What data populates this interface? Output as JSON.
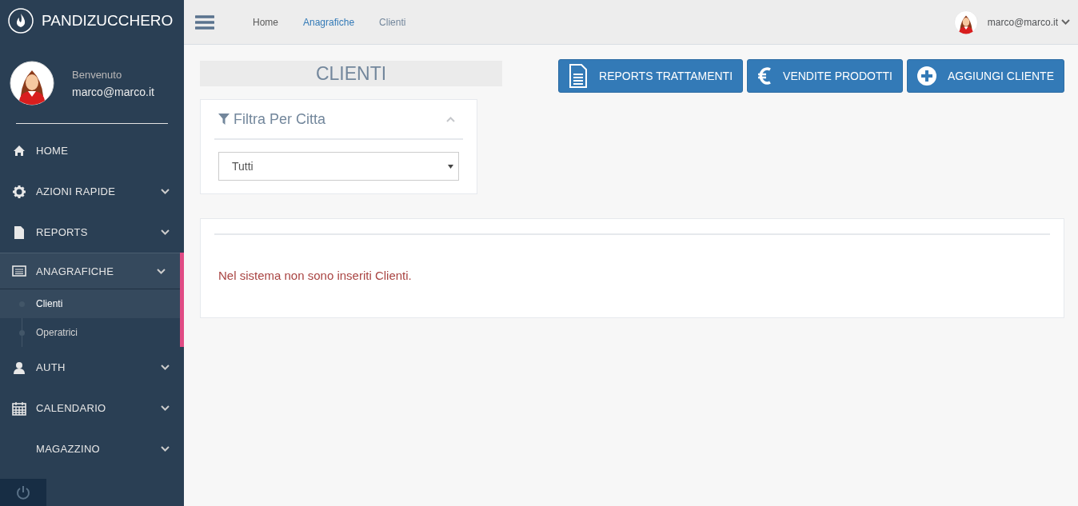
{
  "brand": {
    "title": "PANDIZUCCHERO"
  },
  "profile": {
    "greeting": "Benvenuto",
    "user": "marco@marco.it"
  },
  "sidebar": {
    "items": [
      {
        "label": "HOME",
        "kind": "link",
        "selected": false
      },
      {
        "label": "AZIONI RAPIDE",
        "kind": "submenu",
        "selected": false
      },
      {
        "label": "REPORTS",
        "kind": "submenu",
        "selected": false
      },
      {
        "label": "ANAGRAFICHE",
        "kind": "submenu",
        "expanded": true,
        "selected": true,
        "children": [
          {
            "label": "Clienti",
            "selected": true
          },
          {
            "label": "Operatrici",
            "selected": false
          }
        ]
      },
      {
        "label": "AUTH",
        "kind": "submenu",
        "selected": false
      },
      {
        "label": "CALENDARIO",
        "kind": "submenu",
        "selected": false
      },
      {
        "label": "MAGAZZINO",
        "kind": "submenu",
        "selected": false
      }
    ]
  },
  "breadcrumb": [
    {
      "label": "Home",
      "kind": "plain"
    },
    {
      "label": "Anagrafiche",
      "kind": "link"
    },
    {
      "label": "Clienti",
      "kind": "current"
    }
  ],
  "top_user": {
    "label": "marco@marco.it"
  },
  "page_title": "CLIENTI",
  "buttons": [
    {
      "label": "REPORTS TRATTAMENTI",
      "kind": "report"
    },
    {
      "label": "VENDITE PRODOTTI",
      "kind": "sales"
    },
    {
      "label": "AGGIUNGI CLIENTE",
      "kind": "add"
    }
  ],
  "filter": {
    "title": "Filtra Per Citta",
    "expanded": true,
    "select": {
      "value": "Tutti"
    }
  },
  "message": "Nel sistema non sono inseriti Clienti."
}
